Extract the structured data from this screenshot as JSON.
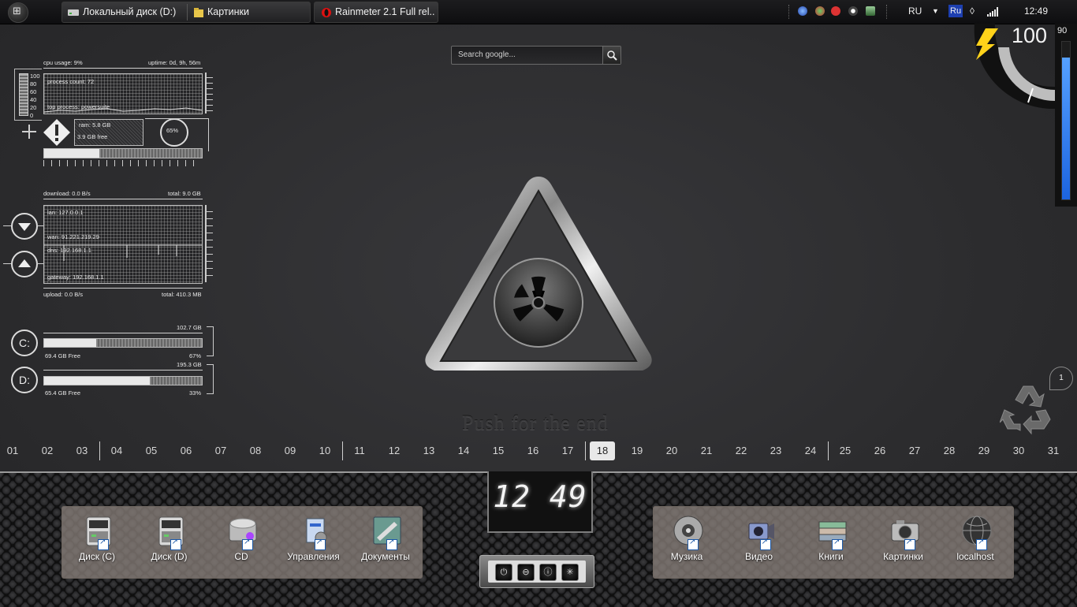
{
  "taskbar": {
    "start_glyph": "⊞",
    "windows": [
      {
        "title": "Локальный диск (D:)"
      },
      {
        "title": "Картинки"
      },
      {
        "title": "Rainmeter 2.1 Full rel..."
      }
    ],
    "language": "RU",
    "language_badge": "Ru",
    "clock": "12:49"
  },
  "system": {
    "cpu_usage": "cpu usage: 9%",
    "uptime": "uptime: 0d, 9h, 56m",
    "process_count": "process count: 72",
    "top_process": "top process: powersuite",
    "cpu_scale": [
      "100",
      "80",
      "60",
      "40",
      "20",
      "0"
    ],
    "ram": "ram: 5.8 GB",
    "ram_free": "3.9 GB free",
    "ram_percent": "65%",
    "ram_usage_fraction": 0.35
  },
  "network": {
    "download": "download: 0.0 B/s",
    "total_down": "total: 9.0 GB",
    "lan": "lan: 127.0.0.1",
    "wan": "wan: 91.221.219.29",
    "dns": "dns: 192.168.1.1",
    "gateway": "gateway: 192.168.1.1",
    "upload": "upload: 0.0 B/s",
    "total_up": "total: 410.3 MB"
  },
  "disks": [
    {
      "letter": "C:",
      "total": "102.7 GB",
      "free": "69.4 GB Free",
      "percent": "67%",
      "used_fraction": 0.33
    },
    {
      "letter": "D:",
      "total": "195.3 GB",
      "free": "65.4 GB Free",
      "percent": "33%",
      "used_fraction": 0.67
    }
  ],
  "search": {
    "placeholder": "Search google..."
  },
  "center": {
    "tagline": "Push for the end"
  },
  "battery": {
    "value": "100",
    "level_label": "90",
    "level_fraction": 0.9
  },
  "recycle": {
    "count": "1"
  },
  "calendar": {
    "days": [
      "01",
      "02",
      "03",
      "04",
      "05",
      "06",
      "07",
      "08",
      "09",
      "10",
      "11",
      "12",
      "13",
      "14",
      "15",
      "16",
      "17",
      "18",
      "19",
      "20",
      "21",
      "22",
      "23",
      "24",
      "25",
      "26",
      "27",
      "28",
      "29",
      "30",
      "31"
    ],
    "today": "18"
  },
  "dock": {
    "clock": "12 49",
    "left_icons": [
      {
        "label": "Диск (C)",
        "icon": "drive-icon"
      },
      {
        "label": "Диск (D)",
        "icon": "drive-icon"
      },
      {
        "label": "CD",
        "icon": "cd-drive-icon"
      },
      {
        "label": "Управления",
        "icon": "control-panel-icon"
      },
      {
        "label": "Документы",
        "icon": "documents-icon"
      }
    ],
    "right_icons": [
      {
        "label": "Музика",
        "icon": "music-icon"
      },
      {
        "label": "Видео",
        "icon": "video-icon"
      },
      {
        "label": "Книги",
        "icon": "books-icon"
      },
      {
        "label": "Картинки",
        "icon": "pictures-icon"
      },
      {
        "label": "localhost",
        "icon": "globe-icon"
      }
    ],
    "power_buttons": [
      {
        "glyph": "⏻",
        "name": "power-icon"
      },
      {
        "glyph": "⊖",
        "name": "sleep-icon"
      },
      {
        "glyph": "ⓘ",
        "name": "info-icon"
      },
      {
        "glyph": "✳",
        "name": "settings-icon"
      }
    ]
  }
}
